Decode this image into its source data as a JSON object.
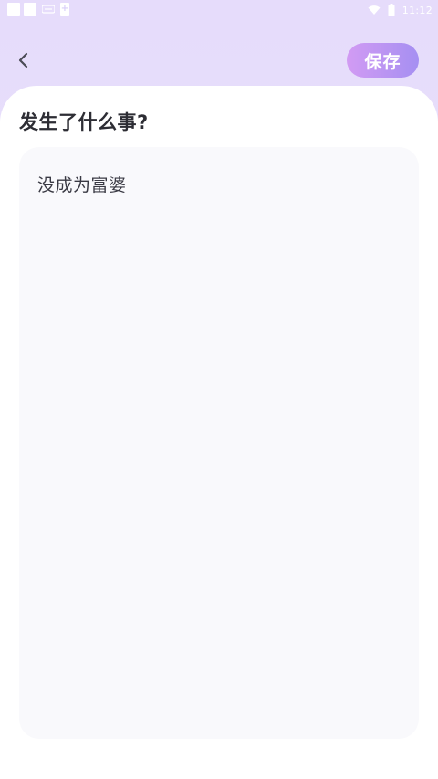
{
  "status_bar": {
    "time": "11:12",
    "icons": [
      "notification-square-icon",
      "notification-square-icon",
      "small-icon",
      "plus-icon",
      "wifi-icon",
      "battery-icon"
    ]
  },
  "header": {
    "back_icon": "chevron-left-icon",
    "save_label": "保存"
  },
  "content": {
    "question": "发生了什么事?",
    "entry_text": "没成为富婆"
  },
  "colors": {
    "background_top": "#e6dcfb",
    "save_gradient_start": "#d29bf3",
    "save_gradient_end": "#a58ff2",
    "sheet": "#ffffff",
    "text_area": "#f9f9fc",
    "text_primary": "#2d2d34"
  }
}
